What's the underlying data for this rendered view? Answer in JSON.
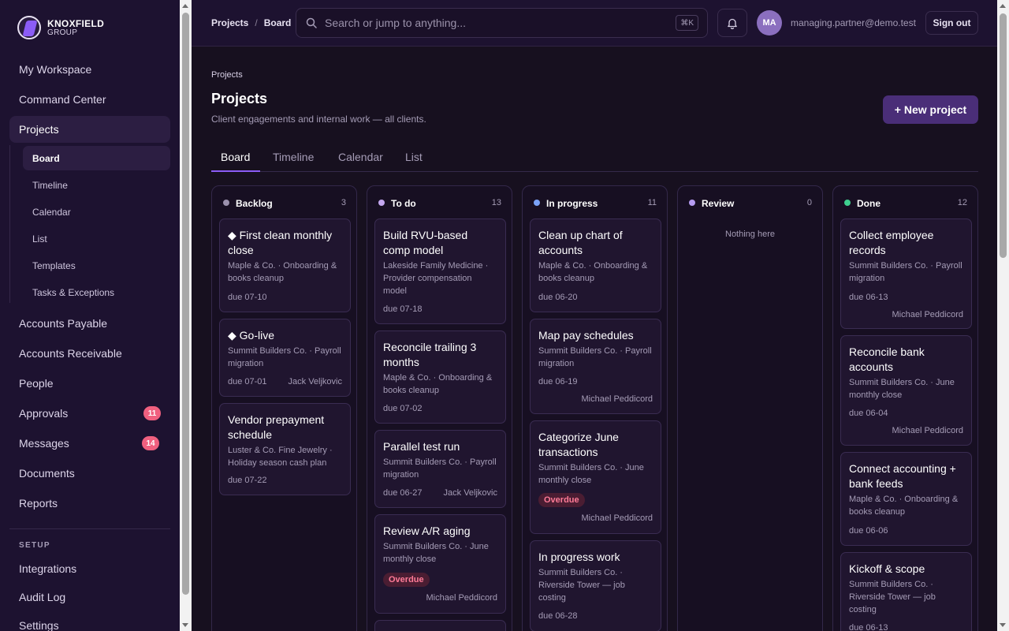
{
  "brand": {
    "line1": "KNOXFIELD",
    "line2": "GROUP"
  },
  "sidebar": {
    "items": [
      {
        "label": "My Workspace"
      },
      {
        "label": "Command Center"
      },
      {
        "label": "Projects"
      },
      {
        "label": "Accounts Payable"
      },
      {
        "label": "Accounts Receivable"
      },
      {
        "label": "People"
      },
      {
        "label": "Approvals",
        "badge": "11"
      },
      {
        "label": "Messages",
        "badge": "14"
      },
      {
        "label": "Documents"
      },
      {
        "label": "Reports"
      }
    ],
    "subitems": [
      {
        "label": "Board"
      },
      {
        "label": "Timeline"
      },
      {
        "label": "Calendar"
      },
      {
        "label": "List"
      },
      {
        "label": "Templates"
      },
      {
        "label": "Tasks & Exceptions"
      }
    ],
    "setup_label": "SETUP",
    "setup_items": [
      {
        "label": "Integrations"
      },
      {
        "label": "Audit Log"
      },
      {
        "label": "Settings"
      }
    ]
  },
  "topbar": {
    "breadcrumb": [
      "Projects",
      "Board"
    ],
    "search_placeholder": "Search or jump to anything...",
    "shortcut": "⌘K",
    "avatar_initials": "MA",
    "email": "managing.partner@demo.test",
    "signout_label": "Sign out"
  },
  "page": {
    "crumb": "Projects",
    "title": "Projects",
    "subtitle": "Client engagements and internal work — all clients.",
    "new_button": "+ New project",
    "tabs": [
      "Board",
      "Timeline",
      "Calendar",
      "List"
    ]
  },
  "colors": {
    "accent": "#8b5cf6",
    "backlog": "#9b91ad",
    "todo": "#c4a7f0",
    "inprogress": "#7aa2f7",
    "review": "#b69cf2",
    "done": "#3ecf8e",
    "overdue": "#ff7b97"
  },
  "board": {
    "columns": [
      {
        "name": "Backlog",
        "count": "3",
        "cards": [
          {
            "title": "◆ First clean monthly close",
            "meta": "Maple & Co. · Onboarding & books cleanup",
            "due": "due 07-10",
            "owner": ""
          },
          {
            "title": "◆ Go-live",
            "meta": "Summit Builders Co. · Payroll migration",
            "due": "due 07-01",
            "owner": "Jack Veljkovic"
          },
          {
            "title": "Vendor prepayment schedule",
            "meta": "Luster & Co. Fine Jewelry · Holiday season cash plan",
            "due": "due 07-22",
            "owner": ""
          }
        ]
      },
      {
        "name": "To do",
        "count": "13",
        "cards": [
          {
            "title": "Build RVU-based comp model",
            "meta": "Lakeside Family Medicine · Provider compensation model",
            "due": "due 07-18",
            "owner": ""
          },
          {
            "title": "Reconcile trailing 3 months",
            "meta": "Maple & Co. · Onboarding & books cleanup",
            "due": "due 07-02",
            "owner": ""
          },
          {
            "title": "Parallel test run",
            "meta": "Summit Builders Co. · Payroll migration",
            "due": "due 06-27",
            "owner": "Jack Veljkovic"
          },
          {
            "title": "Review A/R aging",
            "meta": "Summit Builders Co. · June monthly close",
            "status": "Overdue",
            "owner": "Michael Peddicord"
          }
        ]
      },
      {
        "name": "In progress",
        "count": "11",
        "cards": [
          {
            "title": "Clean up chart of accounts",
            "meta": "Maple & Co. · Onboarding & books cleanup",
            "due": "due 06-20",
            "owner": ""
          },
          {
            "title": "Map pay schedules",
            "meta": "Summit Builders Co. · Payroll migration",
            "due": "due 06-19",
            "owner": "Michael Peddicord"
          },
          {
            "title": "Categorize June transactions",
            "meta": "Summit Builders Co. · June monthly close",
            "status": "Overdue",
            "owner": "Michael Peddicord"
          },
          {
            "title": "In progress work",
            "meta": "Summit Builders Co. · Riverside Tower — job costing",
            "due": "due 06-28",
            "owner": ""
          }
        ]
      },
      {
        "name": "Review",
        "count": "0",
        "empty": "Nothing here",
        "cards": []
      },
      {
        "name": "Done",
        "count": "12",
        "cards": [
          {
            "title": "Collect employee records",
            "meta": "Summit Builders Co. · Payroll migration",
            "due": "due 06-13",
            "owner": "Michael Peddicord"
          },
          {
            "title": "Reconcile bank accounts",
            "meta": "Summit Builders Co. · June monthly close",
            "due": "due 06-04",
            "owner": "Michael Peddicord"
          },
          {
            "title": "Connect accounting + bank feeds",
            "meta": "Maple & Co. · Onboarding & books cleanup",
            "due": "due 06-06",
            "owner": ""
          },
          {
            "title": "Kickoff & scope",
            "meta": "Summit Builders Co. · Riverside Tower — job costing",
            "due": "due 06-13",
            "owner": ""
          }
        ]
      }
    ]
  }
}
